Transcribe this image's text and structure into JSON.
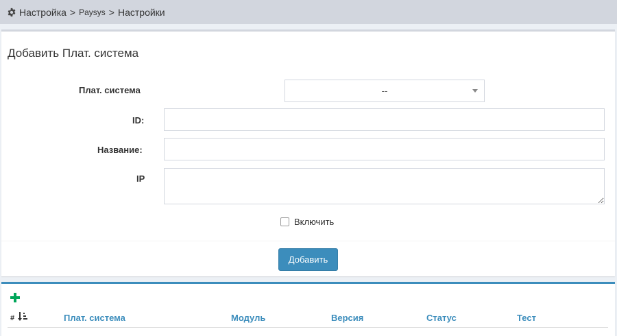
{
  "breadcrumb": {
    "items": [
      "Настройка",
      "Paysys",
      "Настройки"
    ],
    "separator": ">"
  },
  "form": {
    "title": "Добавить Плат. система",
    "paysys_label": "Плат. система",
    "paysys_selected": "--",
    "id_label": "ID:",
    "name_label": "Название:",
    "ip_label": "IP",
    "enable_label": "Включить",
    "submit_label": "Добавить"
  },
  "table": {
    "hash_label": "#",
    "columns": [
      "Плат. система",
      "Модуль",
      "Версия",
      "Статус",
      "Тест"
    ]
  },
  "colors": {
    "primary": "#3c8dbc",
    "success": "#00a65a"
  }
}
